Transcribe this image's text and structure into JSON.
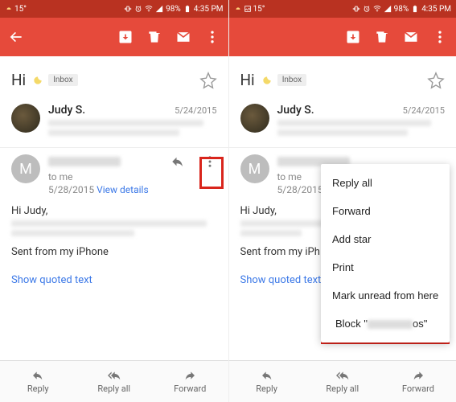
{
  "status": {
    "temp": "15°",
    "battery": "98%",
    "time": "4:35 PM"
  },
  "subject": "Hi",
  "inbox_chip": "Inbox",
  "preview": {
    "sender": "Judy S.",
    "date": "5/24/2015"
  },
  "message": {
    "avatar_letter": "M",
    "to": "to me",
    "date": "5/28/2015",
    "details": "View details",
    "greeting": "Hi Judy,",
    "signature": "Sent from my iPhone",
    "show_quoted": "Show quoted text"
  },
  "bottom": {
    "reply": "Reply",
    "reply_all": "Reply all",
    "forward": "Forward"
  },
  "menu": {
    "reply_all": "Reply all",
    "forward": "Forward",
    "add_star": "Add star",
    "print": "Print",
    "mark_unread": "Mark unread from here",
    "block_pre": "Block \"",
    "block_suf": "os\""
  }
}
